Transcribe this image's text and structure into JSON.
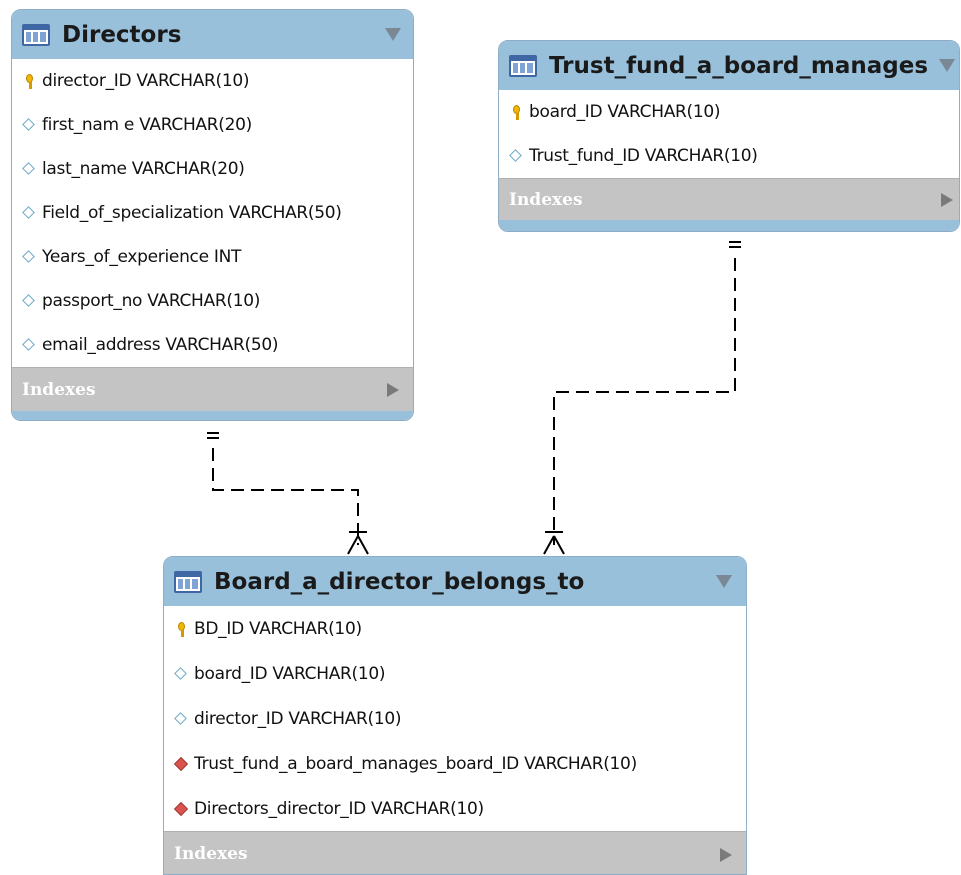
{
  "tables": {
    "directors": {
      "title": "Directors",
      "columns": [
        {
          "text": "director_ID VARCHAR(10)",
          "kind": "primary-key"
        },
        {
          "text": "first_nam e VARCHAR(20)",
          "kind": "column"
        },
        {
          "text": "last_name VARCHAR(20)",
          "kind": "column"
        },
        {
          "text": "Field_of_specialization VARCHAR(50)",
          "kind": "column"
        },
        {
          "text": "Years_of_experience INT",
          "kind": "column"
        },
        {
          "text": "passport_no VARCHAR(10)",
          "kind": "column"
        },
        {
          "text": "email_address VARCHAR(50)",
          "kind": "column"
        }
      ],
      "indexes_label": "Indexes"
    },
    "trust_fund": {
      "title": "Trust_fund_a_board_manages",
      "columns": [
        {
          "text": "board_ID VARCHAR(10)",
          "kind": "primary-key"
        },
        {
          "text": "Trust_fund_ID  VARCHAR(10)",
          "kind": "column"
        }
      ],
      "indexes_label": "Indexes"
    },
    "board": {
      "title": "Board_a_director_belongs_to",
      "columns": [
        {
          "text": "BD_ID VARCHAR(10)",
          "kind": "primary-key"
        },
        {
          "text": "board_ID VARCHAR(10)",
          "kind": "column"
        },
        {
          "text": "director_ID VARCHAR(10)",
          "kind": "column"
        },
        {
          "text": "Trust_fund_a_board_manages_board_ID VARCHAR(10)",
          "kind": "foreign-key"
        },
        {
          "text": "Directors_director_ID VARCHAR(10)",
          "kind": "foreign-key"
        }
      ],
      "indexes_label": "Indexes"
    }
  },
  "relationships": [
    {
      "from": "Directors",
      "to": "Board_a_director_belongs_to",
      "cardinality": "one-to-many",
      "style": "dashed"
    },
    {
      "from": "Trust_fund_a_board_manages",
      "to": "Board_a_director_belongs_to",
      "cardinality": "one-to-many",
      "style": "dashed"
    }
  ],
  "colors": {
    "header": "#99c0db",
    "indexes_bar": "#c4c4c4",
    "connector": "#000000"
  }
}
